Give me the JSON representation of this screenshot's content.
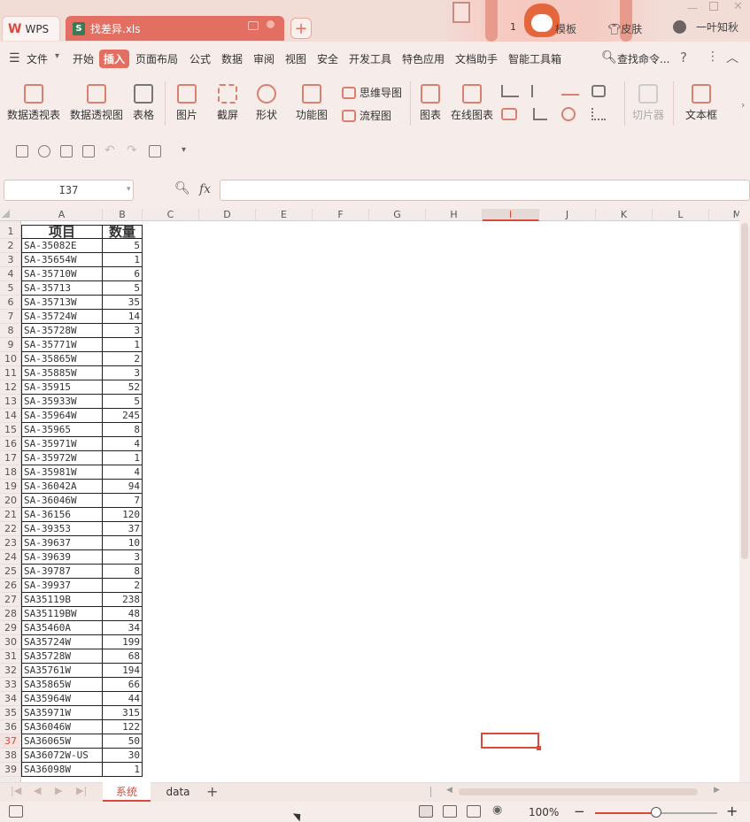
{
  "titlebar": {
    "wps_label": "WPS",
    "file_name": "找差异.xls",
    "mode_badge": "1",
    "template_label": "模板",
    "skin_label": "皮肤",
    "user_name": "一叶知秋"
  },
  "menu": {
    "file": "文件",
    "items": [
      "开始",
      "插入",
      "页面布局",
      "公式",
      "数据",
      "审阅",
      "视图",
      "安全",
      "开发工具",
      "特色应用",
      "文档助手",
      "智能工具箱"
    ],
    "search": "查找命令...",
    "help": "?"
  },
  "ribbon": {
    "pivot_table": "数据透视表",
    "pivot_chart": "数据透视图",
    "table": "表格",
    "picture": "图片",
    "screenshot": "截屏",
    "shape": "形状",
    "function_chart": "功能图",
    "mind_map": "思维导图",
    "flowchart": "流程图",
    "chart": "图表",
    "online_chart": "在线图表",
    "slicer": "切片器",
    "textbox": "文本框"
  },
  "formula_bar": {
    "cell_ref": "I37",
    "fx": "fx",
    "formula": ""
  },
  "grid": {
    "columns": [
      "A",
      "B",
      "C",
      "D",
      "E",
      "F",
      "G",
      "H",
      "I",
      "J",
      "K",
      "L",
      "M"
    ],
    "selected_column": "I",
    "selected_row": "37",
    "header_row": [
      "项目",
      "数量"
    ],
    "rows": [
      [
        "SA-35082E",
        "5"
      ],
      [
        "SA-35654W",
        "1"
      ],
      [
        "SA-35710W",
        "6"
      ],
      [
        "SA-35713",
        "5"
      ],
      [
        "SA-35713W",
        "35"
      ],
      [
        "SA-35724W",
        "14"
      ],
      [
        "SA-35728W",
        "3"
      ],
      [
        "SA-35771W",
        "1"
      ],
      [
        "SA-35865W",
        "2"
      ],
      [
        "SA-35885W",
        "3"
      ],
      [
        "SA-35915",
        "52"
      ],
      [
        "SA-35933W",
        "5"
      ],
      [
        "SA-35964W",
        "245"
      ],
      [
        "SA-35965",
        "8"
      ],
      [
        "SA-35971W",
        "4"
      ],
      [
        "SA-35972W",
        "1"
      ],
      [
        "SA-35981W",
        "4"
      ],
      [
        "SA-36042A",
        "94"
      ],
      [
        "SA-36046W",
        "7"
      ],
      [
        "SA-36156",
        "120"
      ],
      [
        "SA-39353",
        "37"
      ],
      [
        "SA-39637",
        "10"
      ],
      [
        "SA-39639",
        "3"
      ],
      [
        "SA-39787",
        "8"
      ],
      [
        "SA-39937",
        "2"
      ],
      [
        "SA35119B",
        "238"
      ],
      [
        "SA35119BW",
        "48"
      ],
      [
        "SA35460A",
        "34"
      ],
      [
        "SA35724W",
        "199"
      ],
      [
        "SA35728W",
        "68"
      ],
      [
        "SA35761W",
        "194"
      ],
      [
        "SA35865W",
        "66"
      ],
      [
        "SA35964W",
        "44"
      ],
      [
        "SA35971W",
        "315"
      ],
      [
        "SA36046W",
        "122"
      ],
      [
        "SA36065W",
        "50"
      ],
      [
        "SA36072W-US",
        "30"
      ],
      [
        "SA36098W",
        "1"
      ]
    ]
  },
  "sheets": {
    "tabs": [
      "系统",
      "data"
    ],
    "active": "系统"
  },
  "status": {
    "zoom": "100%",
    "zoom_level": 0.5
  }
}
